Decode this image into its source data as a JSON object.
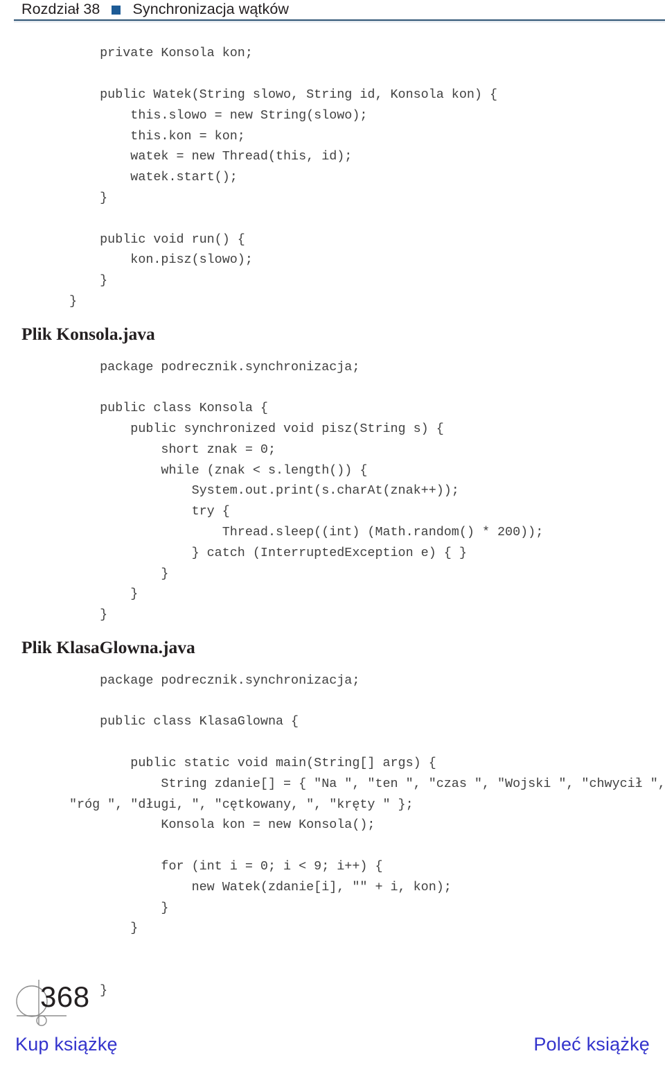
{
  "running_head": {
    "chapter": "Rozdział 38",
    "bullet_icon": "square-bullet-icon",
    "title": "Synchronizacja wątków",
    "rule_color": "#2a5172",
    "bullet_color": "#1d5b96"
  },
  "code_blocks": {
    "watek_tail": [
      "    private Konsola kon;",
      "",
      "    public Watek(String slowo, String id, Konsola kon) {",
      "        this.slowo = new String(slowo);",
      "        this.kon = kon;",
      "        watek = new Thread(this, id);",
      "        watek.start();",
      "    }",
      "",
      "    public void run() {",
      "        kon.pisz(slowo);",
      "    }",
      "}"
    ],
    "konsola": [
      "    package podrecznik.synchronizacja;",
      "",
      "    public class Konsola {",
      "        public synchronized void pisz(String s) {",
      "            short znak = 0;",
      "            while (znak < s.length()) {",
      "                System.out.print(s.charAt(znak++));",
      "                try {",
      "                    Thread.sleep((int) (Math.random() * 200));",
      "                } catch (InterruptedException e) { }",
      "            }",
      "        }",
      "    }"
    ],
    "klasaglowna": [
      "    package podrecznik.synchronizacja;",
      "",
      "    public class KlasaGlowna {",
      "",
      "        public static void main(String[] args) {",
      "            String zdanie[] = { \"Na \", \"ten \", \"czas \", \"Wojski \", \"chwycił \",",
      "\"róg \", \"długi, \", \"cętkowany, \", \"kręty \" };",
      "            Konsola kon = new Konsola();",
      "",
      "            for (int i = 0; i < 9; i++) {",
      "                new Watek(zdanie[i], \"\" + i, kon);",
      "            }",
      "        }",
      "",
      "",
      "    }"
    ]
  },
  "headings": {
    "konsola_file": "Plik Konsola.java",
    "klasaglowna_file": "Plik KlasaGlowna.java"
  },
  "footer": {
    "page_number": "368",
    "folio_mark_icon": "helion-circle-mark-icon",
    "buy_link": "Kup książkę",
    "recommend_link": "Poleć książkę",
    "link_color": "#3333cc"
  }
}
